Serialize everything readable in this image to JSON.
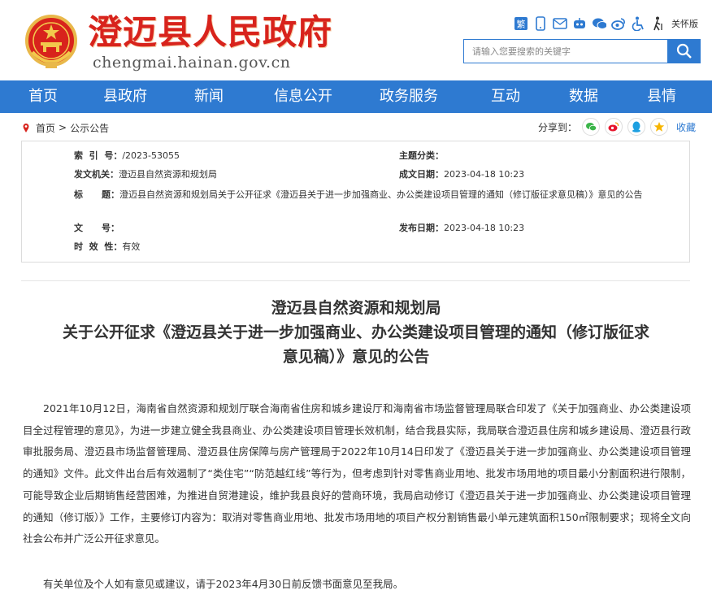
{
  "header": {
    "site_title": "澄迈县人民政府",
    "site_domain": "chengmai.hainan.gov.cn",
    "top_icons": [
      "simplified-chinese-icon",
      "mobile-icon",
      "email-icon",
      "robot-icon",
      "wechat-icon",
      "weibo-icon",
      "accessibility-icon"
    ],
    "traditional_label": "繁",
    "care_label": "关怀版",
    "search_placeholder": "请输入您要搜索的关键字"
  },
  "nav": {
    "items": [
      "首页",
      "县政府",
      "新闻",
      "信息公开",
      "政务服务",
      "互动",
      "数据",
      "县情"
    ]
  },
  "breadcrumb": {
    "home": "首页",
    "separator": ">",
    "current": "公示公告"
  },
  "share": {
    "label": "分享到：",
    "icons": [
      "wechat-icon",
      "weibo-icon",
      "qq-icon",
      "qzone-icon"
    ],
    "favorite": "收藏"
  },
  "meta": {
    "index_label": "索  引  号：",
    "index_value": "/2023-53055",
    "topic_label": "主题分类：",
    "topic_value": "",
    "issuer_label": "发文机关：",
    "issuer_value": "澄迈县自然资源和规划局",
    "date_label": "成文日期：",
    "date_value": "2023-04-18 10:23",
    "title_label": "标      题：",
    "title_value": "澄迈县自然资源和规划局关于公开征求《澄迈县关于进一步加强商业、办公类建设项目管理的通知（修订版征求意见稿）》意见的公告",
    "docno_label": "文      号：",
    "docno_value": "",
    "publish_label": "发布日期：",
    "publish_value": "2023-04-18 10:23",
    "validity_label": "时  效  性：",
    "validity_value": "有效"
  },
  "article": {
    "title_line1": "澄迈县自然资源和规划局",
    "title_line2": "关于公开征求《澄迈县关于进一步加强商业、办公类建设项目管理的通知（修订版征求",
    "title_line3": "意见稿）》意见的公告",
    "paragraph1": "2021年10月12日，海南省自然资源和规划厅联合海南省住房和城乡建设厅和海南省市场监督管理局联合印发了《关于加强商业、办公类建设项目全过程管理的意见》，为进一步建立健全我县商业、办公类建设项目管理长效机制，结合我县实际，我局联合澄迈县住房和城乡建设局、澄迈县行政审批服务局、澄迈县市场监督管理局、澄迈县住房保障与房产管理局于2022年10月14日印发了《澄迈县关于进一步加强商业、办公类建设项目管理的通知》文件。此文件出台后有效遏制了“类住宅”“防范越红线”等行为，但考虑到针对零售商业用地、批发市场用地的项目最小分割面积进行限制，可能导致企业后期销售经营困难，为推进自贸港建设，维护我县良好的营商环境，我局启动修订《澄迈县关于进一步加强商业、办公类建设项目管理的通知（修订版）》工作，主要修订内容为：取消对零售商业用地、批发市场用地的项目产权分割销售最小单元建筑面积150㎡限制要求；现将全文向社会公布并广泛公开征求意见。",
    "paragraph2": "有关单位及个人如有意见或建议，请于2023年4月30日前反馈书面意见至我局。"
  },
  "colors": {
    "brand_blue": "#2e7ad1",
    "title_red": "#d8231c"
  }
}
